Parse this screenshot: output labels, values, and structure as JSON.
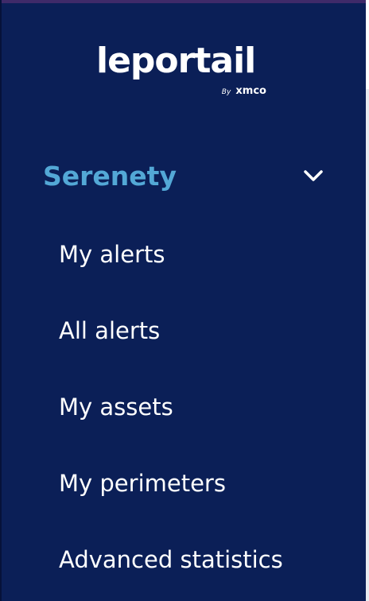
{
  "logo": {
    "wordmark": "leportail",
    "by": "By",
    "brand": "xmco"
  },
  "section": {
    "title": "Serenety",
    "expanded": true,
    "chevron_icon": "chevron-down-icon"
  },
  "nav": {
    "items": [
      {
        "label": "My alerts"
      },
      {
        "label": "All alerts"
      },
      {
        "label": "My assets"
      },
      {
        "label": "My perimeters"
      },
      {
        "label": "Advanced statistics"
      }
    ]
  },
  "colors": {
    "sidebar_bg": "#0b1f57",
    "section_title": "#53a8d6",
    "nav_text": "#ffffff",
    "top_bar": "#3f2a69"
  }
}
